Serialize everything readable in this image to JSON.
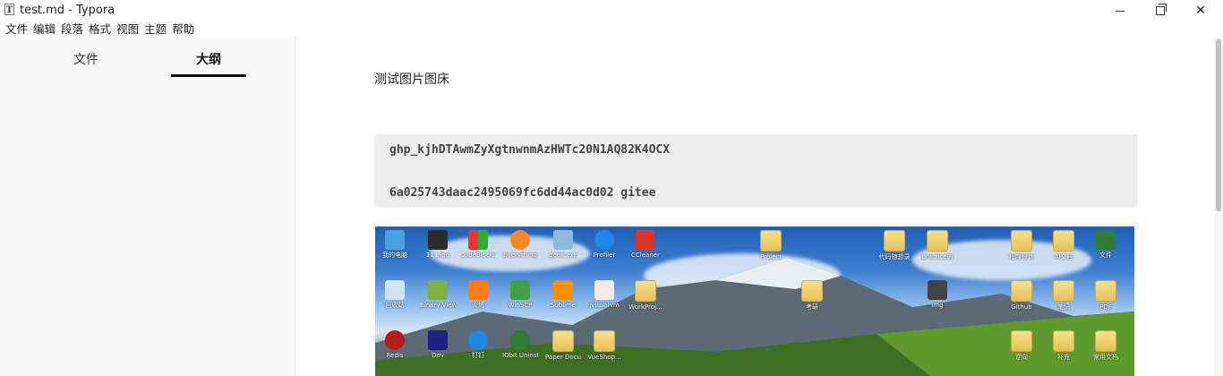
{
  "window": {
    "title": "test.md - Typora",
    "app_icon_letter": "T"
  },
  "menubar": {
    "items": [
      "文件",
      "编辑",
      "段落",
      "格式",
      "视图",
      "主题",
      "帮助"
    ]
  },
  "sidebar": {
    "tabs": [
      {
        "label": "文件",
        "active": false
      },
      {
        "label": "大纲",
        "active": true
      }
    ]
  },
  "document": {
    "heading": "测试图片图床",
    "code_lines": [
      "ghp_kjhDTAwmZyXgtnwnmAzHWTc20N1AQ82K4OCX",
      "6a025743daac2495069fc6dd44ac0d02 gitee"
    ]
  },
  "desktop_image": {
    "icons": [
      "我的电脑",
      "111.jpg",
      "CodeBlocks",
      "Everything",
      "geek.exe",
      "Profiler",
      "CCleaner",
      "Project",
      "代码随想录",
      "practice的",
      "程序设计",
      "AI文档",
      "文件",
      "回收站",
      "Binary Viewer",
      "火绒",
      "WinSCP",
      "Sublime",
      "jvisualvm",
      "WorkProj...",
      "考研",
      "img",
      "Github",
      "笔记",
      "PDF",
      "Redis",
      "Dev",
      "钉钉",
      "IObit Uninstaller",
      "Paper Document",
      "VueShop...",
      "逆向",
      "补充",
      "常用文档"
    ]
  }
}
